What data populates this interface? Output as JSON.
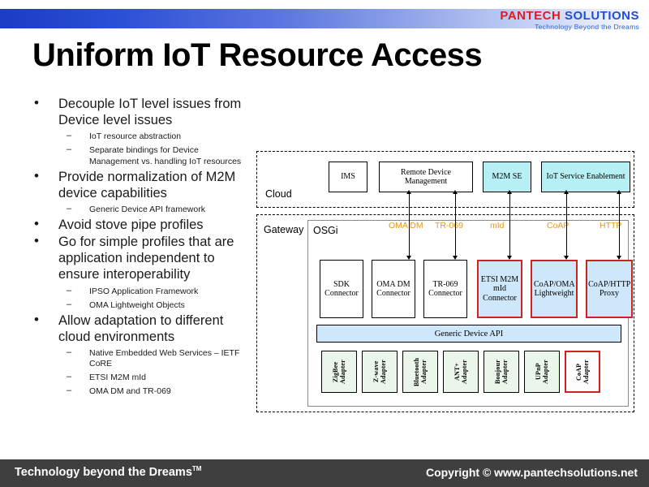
{
  "brand": {
    "name_part1": "PANTECH",
    "name_part2": "SOLUTIONS",
    "tagline": "Technology Beyond the Dreams",
    "red": "#e01b1b",
    "blue": "#1f4fd8"
  },
  "title": "Uniform IoT Resource Access",
  "bullets": [
    {
      "level": 1,
      "text": "Decouple IoT level issues from Device level issues"
    },
    {
      "level": 2,
      "text": "IoT resource abstraction"
    },
    {
      "level": 2,
      "text": "Separate bindings for Device Management vs. handling IoT resources"
    },
    {
      "level": 1,
      "text": "Provide normalization of M2M device capabilities"
    },
    {
      "level": 2,
      "text": "Generic Device API framework"
    },
    {
      "level": 1,
      "text": "Avoid stove pipe profiles"
    },
    {
      "level": 1,
      "text": "Go for simple profiles that are application independent to ensure interoperability"
    },
    {
      "level": 2,
      "text": "IPSO Application Framework"
    },
    {
      "level": 2,
      "text": "OMA Lightweight Objects"
    },
    {
      "level": 1,
      "text": "Allow adaptation to different cloud environments"
    },
    {
      "level": 2,
      "text": "Native Embedded Web Services – IETF CoRE"
    },
    {
      "level": 2,
      "text": "ETSI M2M mId"
    },
    {
      "level": 2,
      "text": "OMA DM and TR-069"
    }
  ],
  "diagram": {
    "cloud_label": "Cloud",
    "gateway_label": "Gateway",
    "osgi_label": "OSGi",
    "generic_api_label": "Generic Device API",
    "cloud_nodes": [
      {
        "label": "IMS",
        "style": "white"
      },
      {
        "label": "Remote Device Management",
        "style": "white"
      },
      {
        "label": "M2M SE",
        "style": "cyan"
      },
      {
        "label": "IoT Service Enablement",
        "style": "cyan"
      }
    ],
    "protocols": [
      {
        "label": "OMA DM"
      },
      {
        "label": "TR-069"
      },
      {
        "label": "mId"
      },
      {
        "label": "CoAP"
      },
      {
        "label": "HTTP"
      }
    ],
    "connectors": [
      {
        "label": "SDK Connector",
        "style": "white"
      },
      {
        "label": "OMA DM Connector",
        "style": "white"
      },
      {
        "label": "TR-069 Connector",
        "style": "white"
      },
      {
        "label": "ETSI M2M mId Connector",
        "style": "redbl"
      },
      {
        "label": "CoAP/OMA Lightweight",
        "style": "redbl"
      },
      {
        "label": "CoAP/HTTP Proxy",
        "style": "redbl"
      }
    ],
    "adapters": [
      {
        "label": "ZigBee Adapter",
        "style": "green"
      },
      {
        "label": "Z-wave Adapter",
        "style": "green"
      },
      {
        "label": "Bluetooth Adapter",
        "style": "green"
      },
      {
        "label": "ANT+ Adapter",
        "style": "green"
      },
      {
        "label": "Bonjour Adapter",
        "style": "green"
      },
      {
        "label": "UPnP Adapter",
        "style": "green"
      },
      {
        "label": "CoAP Adapter",
        "style": "greenred"
      }
    ],
    "colors": {
      "cyan": "#b6f0f4",
      "light_blue": "#cfe7fb",
      "red_border": "#cc2222",
      "green_fill": "#eaf6ea",
      "protocol_orange": "#e09a22"
    }
  },
  "footer": {
    "left": "Technology beyond the Dreams",
    "left_tm": "TM",
    "right": "Copyright © www.pantechsolutions.net"
  }
}
